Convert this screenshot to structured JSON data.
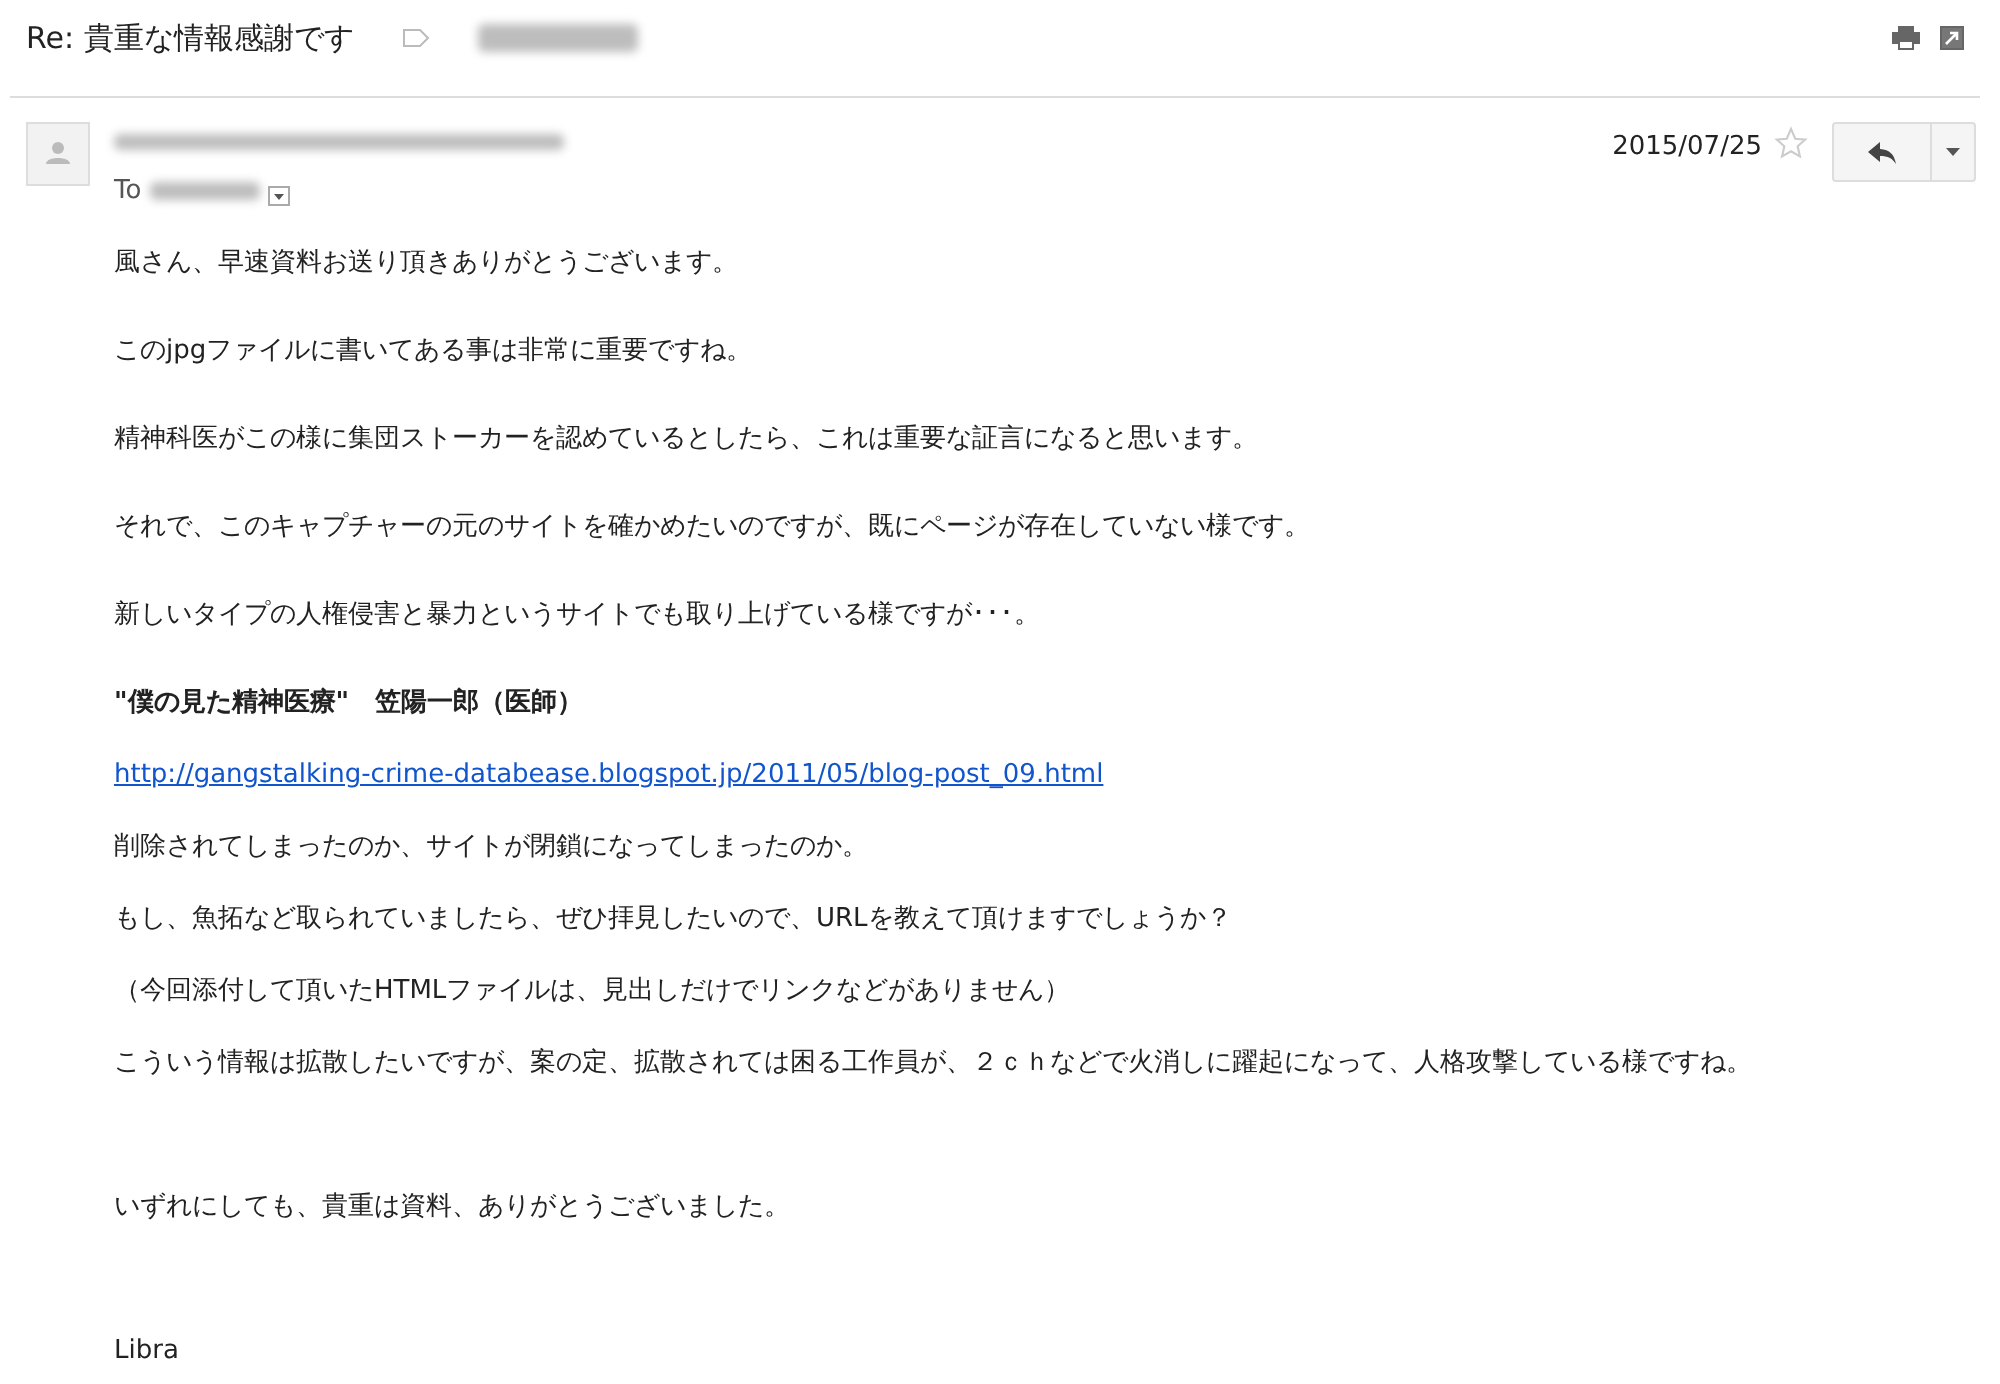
{
  "message": {
    "subject": "Re: 貴重な情報感謝です",
    "to_label": "To",
    "date": "2015/07/25",
    "starred": false
  },
  "body": [
    {
      "kind": "text",
      "text": "風さん、早速資料お送り頂きありがとうございます。"
    },
    {
      "kind": "text",
      "text": "このjpgファイルに書いてある事は非常に重要ですね。"
    },
    {
      "kind": "text",
      "text": "精神科医がこの様に集団ストーカーを認めているとしたら、これは重要な証言になると思います。"
    },
    {
      "kind": "text",
      "text": "それで、このキャプチャーの元のサイトを確かめたいのですが、既にページが存在していない様です。"
    },
    {
      "kind": "text",
      "text": "新しいタイプの人権侵害と暴力というサイトでも取り上げている様ですが･･･。"
    },
    {
      "kind": "title",
      "text": "\"僕の見た精神医療\"　笠陽一郎（医師）"
    },
    {
      "kind": "link",
      "text": "http://gangstalking-crime-databease.blogspot.jp/2011/05/blog-post_09.html"
    },
    {
      "kind": "text",
      "text": "削除されてしまったのか、サイトが閉鎖になってしまったのか。"
    },
    {
      "kind": "text",
      "text": "もし、魚拓など取られていましたら、ぜひ拝見したいので、URLを教えて頂けますでしょうか？"
    },
    {
      "kind": "text",
      "text": "（今回添付して頂いたHTMLファイルは、見出しだけでリンクなどがありません）"
    },
    {
      "kind": "text",
      "text": "こういう情報は拡散したいですが、案の定、拡散されては困る工作員が、２ｃｈなどで火消しに躍起になって、人格攻撃している様ですね。"
    },
    {
      "kind": "spaced",
      "text": "いずれにしても、貴重は資料、ありがとうございました。"
    },
    {
      "kind": "spaced",
      "text": "Libra"
    }
  ]
}
